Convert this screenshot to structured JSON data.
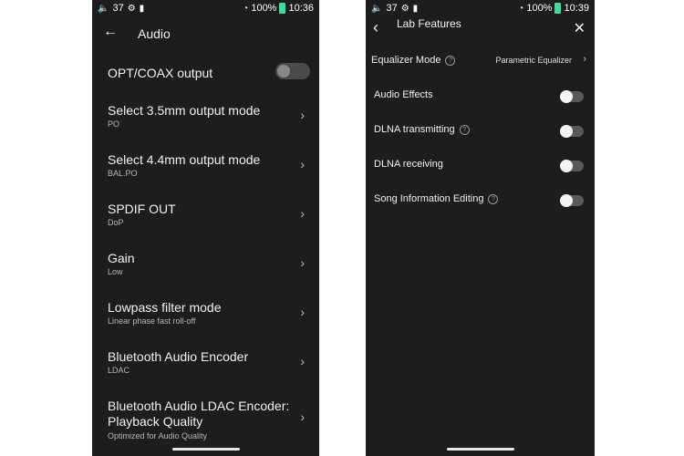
{
  "status_left": {
    "battery": "37",
    "time_left": "10:36",
    "time_right": "10:39",
    "battery_pct": "100%"
  },
  "audio_screen": {
    "title": "Audio",
    "opt_coax": {
      "label": "OPT/COAX output",
      "enabled": false
    },
    "items": [
      {
        "title": "Select 3.5mm output mode",
        "subtitle": "PO"
      },
      {
        "title": "Select 4.4mm output mode",
        "subtitle": "BAL.PO"
      },
      {
        "title": "SPDIF OUT",
        "subtitle": "DoP"
      },
      {
        "title": "Gain",
        "subtitle": "Low"
      },
      {
        "title": "Lowpass filter mode",
        "subtitle": "Linear phase fast roll-off"
      },
      {
        "title": "Bluetooth Audio Encoder",
        "subtitle": "LDAC"
      },
      {
        "title_line1": "Bluetooth Audio LDAC Encoder:",
        "title_line2": "Playback Quality",
        "subtitle": "Optimized for Audio Quality"
      }
    ]
  },
  "lab_screen": {
    "title": "Lab Features",
    "equalizer_label": "Equalizer Mode",
    "equalizer_value": "Parametric Equalizer",
    "toggles": [
      {
        "label": "Audio Effects",
        "help": false,
        "enabled": false
      },
      {
        "label": "DLNA transmitting",
        "help": true,
        "enabled": false
      },
      {
        "label": "DLNA receiving",
        "help": false,
        "enabled": false
      },
      {
        "label": "Song Information Editing",
        "help": true,
        "enabled": false
      }
    ]
  },
  "icons": {
    "back": "arrow-left-icon",
    "chevron": "chevron-right-icon",
    "close": "close-icon",
    "help": "question-mark-icon"
  }
}
